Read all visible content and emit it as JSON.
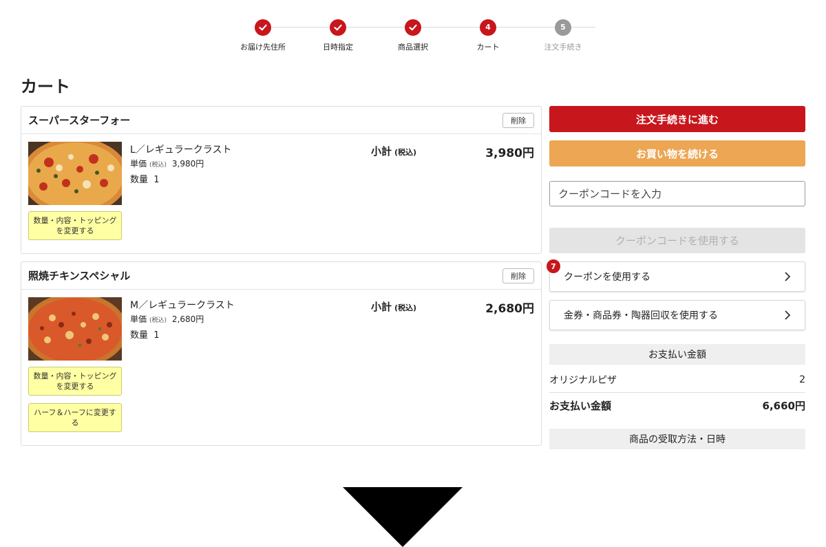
{
  "stepper": {
    "steps": [
      {
        "label": "お届け先住所",
        "state": "done"
      },
      {
        "label": "日時指定",
        "state": "done"
      },
      {
        "label": "商品選択",
        "state": "done"
      },
      {
        "label": "カート",
        "state": "current",
        "number": "4"
      },
      {
        "label": "注文手続き",
        "state": "pending",
        "number": "5"
      }
    ]
  },
  "page_title": "カート",
  "items": [
    {
      "name": "スーパースターフォー",
      "delete_label": "削除",
      "crust": "L／レギュラークラスト",
      "unit_label": "単価",
      "tax_note": "(税込)",
      "unit_price": "3,980円",
      "qty_label": "数量",
      "qty": "1",
      "subtotal_label": "小計",
      "subtotal_tax": "(税込)",
      "price": "3,980円",
      "change_button": "数量・内容・トッピングを変更する"
    },
    {
      "name": "照焼チキンスペシャル",
      "delete_label": "削除",
      "crust": "M／レギュラークラスト",
      "unit_label": "単価",
      "tax_note": "(税込)",
      "unit_price": "2,680円",
      "qty_label": "数量",
      "qty": "1",
      "subtotal_label": "小計",
      "subtotal_tax": "(税込)",
      "price": "2,680円",
      "change_button": "数量・内容・トッピングを変更する",
      "half_button": "ハーフ＆ハーフに変更する"
    }
  ],
  "sidebar": {
    "checkout_button": "注文手続きに進む",
    "continue_button": "お買い物を続ける",
    "coupon_placeholder": "クーポンコードを入力",
    "coupon_apply_button": "クーポンコードを使用する",
    "coupon_badge": "7",
    "coupon_link": "クーポンを使用する",
    "voucher_link": "金券・商品券・陶器回収を使用する",
    "payment_header": "お支払い金額",
    "original_pizza_label": "オリジナルピザ",
    "original_pizza_count": "2",
    "total_label": "お支払い金額",
    "total_value": "6,660円",
    "pickup_header": "商品の受取方法・日時"
  },
  "colors": {
    "brand_red": "#c8161d",
    "continue_orange": "#eca654",
    "edit_yellow": "#ffffa4"
  }
}
